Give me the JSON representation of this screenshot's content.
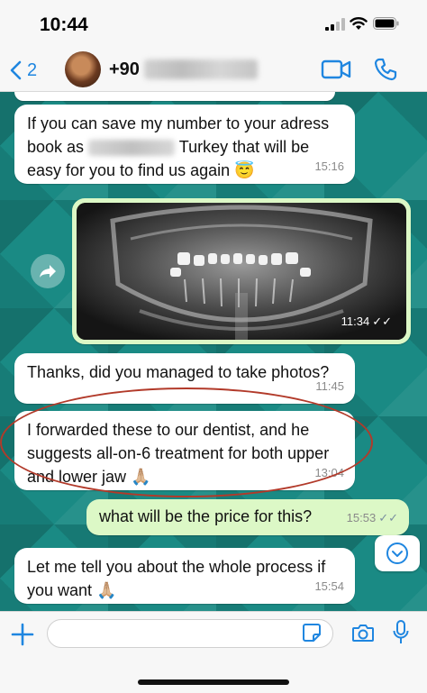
{
  "status_bar": {
    "time": "10:44"
  },
  "header": {
    "back_count": "2",
    "contact_prefix": "+90",
    "icons": {
      "back": "chevron-left-icon",
      "video": "video-camera-icon",
      "call": "phone-icon"
    }
  },
  "messages": [
    {
      "direction": "in",
      "text": "If you can save my number to your adress book as",
      "text_after": "Turkey that will be easy for you to find us again 😇",
      "time": "15:16"
    },
    {
      "direction": "out",
      "type": "image",
      "image_desc": "dental x-ray",
      "time": "11:34",
      "status": "read"
    },
    {
      "direction": "in",
      "text": "Thanks, did you managed to take photos?",
      "time": "11:45"
    },
    {
      "direction": "in",
      "text": "I forwarded these to our dentist, and he suggests all-on-6 treatment for both upper and lower jaw 🙏🏼",
      "time": "13:04"
    },
    {
      "direction": "out",
      "text": "what will be the price for this?",
      "time": "15:53",
      "status": "delivered"
    },
    {
      "direction": "in",
      "text": "Let me tell you about the whole process if you want 🙏🏼",
      "time": "15:54"
    }
  ],
  "input": {
    "placeholder": ""
  },
  "colors": {
    "accent": "#1f86e0",
    "outgoing_bubble": "#dcf8c6",
    "incoming_bubble": "#ffffff",
    "chat_bg": "#1a8a84",
    "annotation": "#b23a2a"
  }
}
